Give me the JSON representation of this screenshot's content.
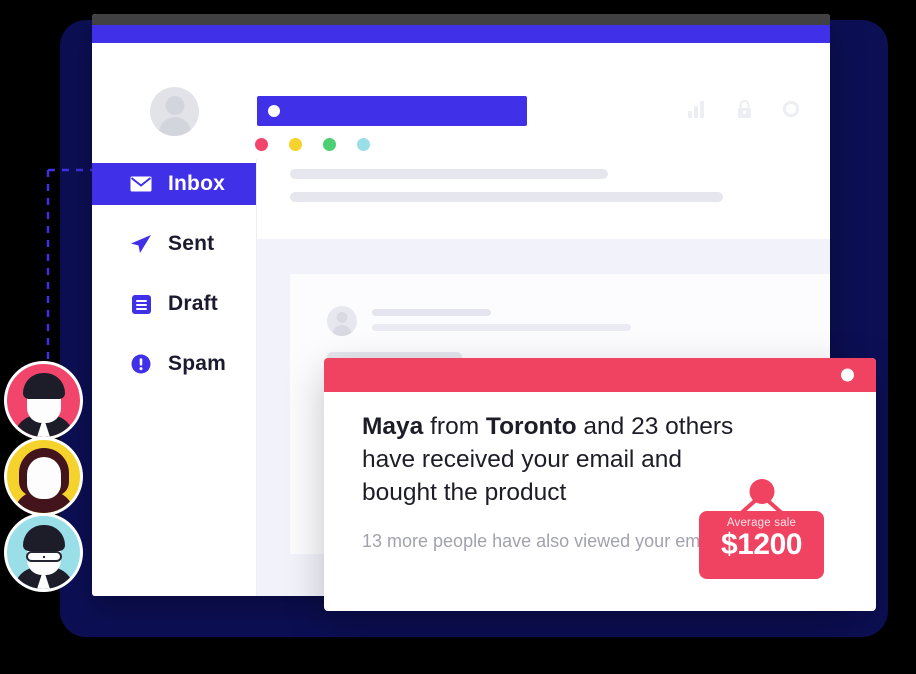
{
  "app": {
    "window_title": "",
    "accent_color": "#4030e8",
    "navy_backdrop_color": "#0c0f54",
    "topbar_color": "#414042"
  },
  "header": {
    "avatar_name": "user-avatar-placeholder",
    "search_placeholder": "",
    "search_value": "",
    "status_dots": [
      {
        "name": "dot-red",
        "color": "#f2456b"
      },
      {
        "name": "dot-yellow",
        "color": "#f6d22c"
      },
      {
        "name": "dot-green",
        "color": "#4cd073"
      },
      {
        "name": "dot-blue",
        "color": "#9adfe8"
      }
    ],
    "icons": [
      {
        "name": "bar-chart-icon",
        "label": "Analytics"
      },
      {
        "name": "lock-icon",
        "label": "Security"
      },
      {
        "name": "settings-circle-icon",
        "label": "Settings"
      }
    ]
  },
  "sidebar": {
    "items": [
      {
        "label": "Inbox",
        "icon": "envelope-icon",
        "active": true
      },
      {
        "label": "Sent",
        "icon": "paper-plane-icon",
        "active": false
      },
      {
        "label": "Draft",
        "icon": "document-lines-icon",
        "active": false
      },
      {
        "label": "Spam",
        "icon": "exclamation-circle-icon",
        "active": false
      }
    ]
  },
  "main": {
    "skeleton_rows": 2,
    "inner_card_present": true
  },
  "avatars": [
    {
      "name": "avatar-maya",
      "bg": "#f2456b",
      "style": "short-dark-hair"
    },
    {
      "name": "avatar-second",
      "bg": "#f6d22c",
      "style": "long-brown-hair"
    },
    {
      "name": "avatar-third",
      "bg": "#9adfe8",
      "style": "glasses"
    }
  ],
  "notification": {
    "header_color": "#ef4361",
    "title_parts": [
      {
        "text": "Maya",
        "bold": true
      },
      {
        "text": " from ",
        "bold": false
      },
      {
        "text": "Toronto",
        "bold": true
      },
      {
        "text": " and 23 others have received your email and bought the product",
        "bold": false
      }
    ],
    "title_plain": "Maya from Toronto and 23 others have received your email and bought the product",
    "subtitle": "13 more people have also viewed your email",
    "close_dot": "notification-status-dot"
  },
  "price_tag": {
    "label": "Average sale",
    "value": "$1200",
    "color": "#ef4361"
  }
}
